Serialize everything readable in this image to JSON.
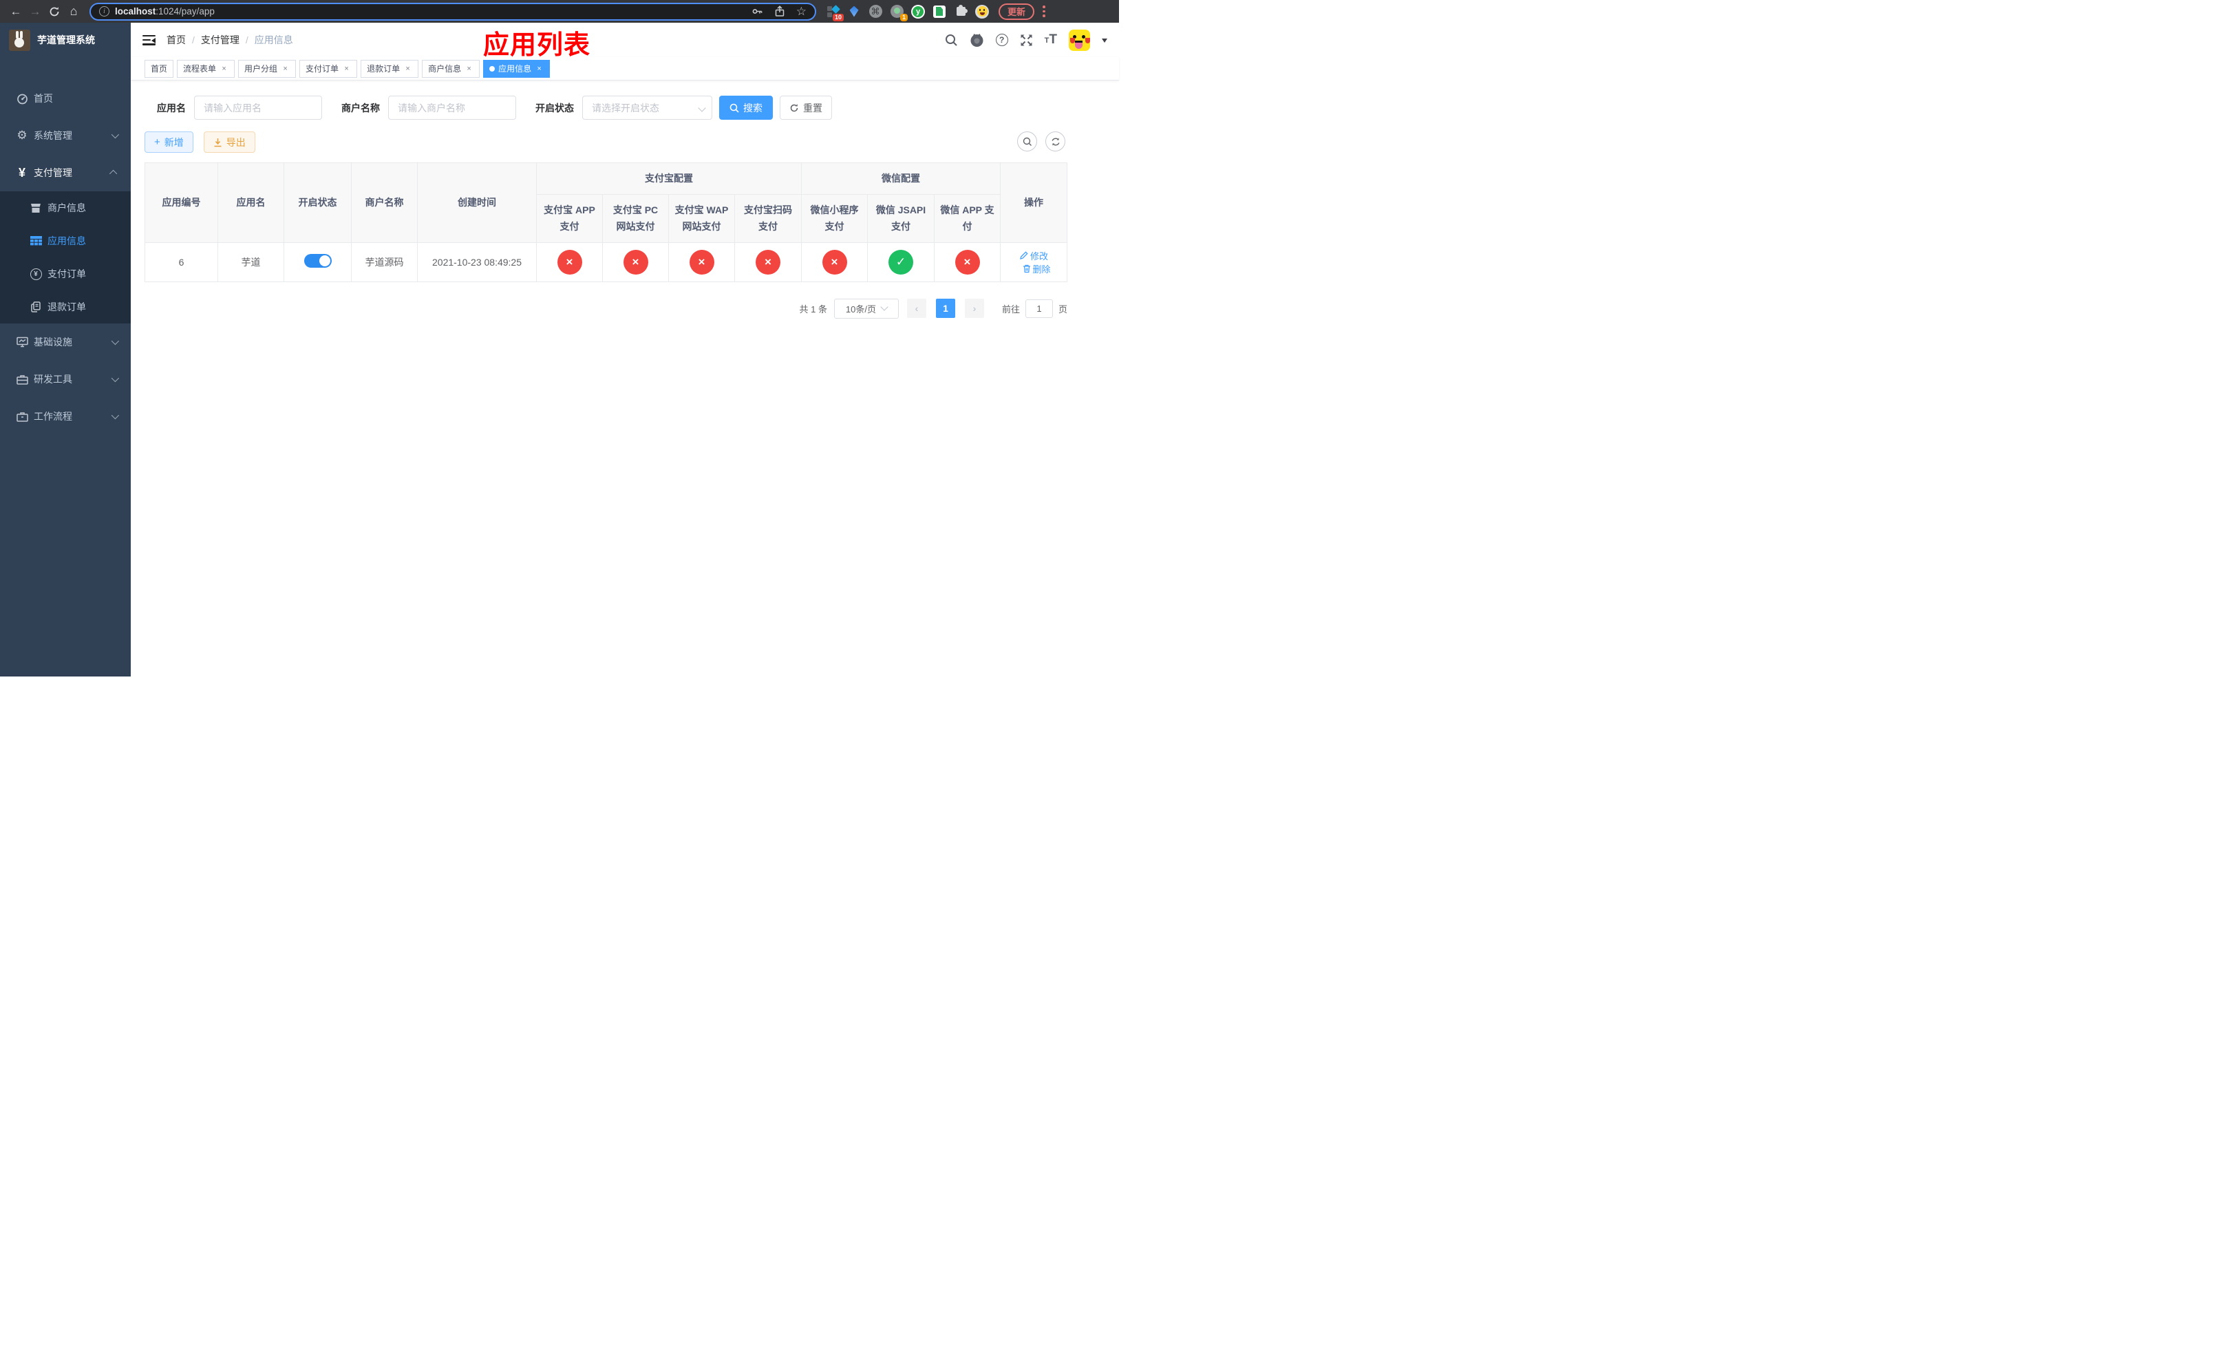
{
  "browser": {
    "url_host": "localhost",
    "url_path": ":1024/pay/app",
    "update_label": "更新",
    "ext_badge_1": "10",
    "ext_badge_2": "1",
    "ext_y_letter": "y"
  },
  "sidebar": {
    "title": "芋道管理系统",
    "menu_top": [
      {
        "label": "首页",
        "expandable": false
      },
      {
        "label": "系统管理",
        "expandable": true,
        "state": "collapsed"
      },
      {
        "label": "支付管理",
        "expandable": true,
        "state": "expanded"
      }
    ],
    "submenu": [
      {
        "label": "商户信息",
        "active": false
      },
      {
        "label": "应用信息",
        "active": true
      },
      {
        "label": "支付订单",
        "active": false
      },
      {
        "label": "退款订单",
        "active": false
      }
    ],
    "menu_bottom": [
      {
        "label": "基础设施",
        "expandable": true,
        "state": "collapsed"
      },
      {
        "label": "研发工具",
        "expandable": true,
        "state": "collapsed"
      },
      {
        "label": "工作流程",
        "expandable": true,
        "state": "collapsed"
      }
    ]
  },
  "navbar": {
    "breadcrumb": [
      "首页",
      "支付管理",
      "应用信息"
    ],
    "annotation": "应用列表"
  },
  "tabs": [
    {
      "label": "首页",
      "closable": false,
      "active": false
    },
    {
      "label": "流程表单",
      "closable": true,
      "active": false
    },
    {
      "label": "用户分组",
      "closable": true,
      "active": false
    },
    {
      "label": "支付订单",
      "closable": true,
      "active": false
    },
    {
      "label": "退款订单",
      "closable": true,
      "active": false
    },
    {
      "label": "商户信息",
      "closable": true,
      "active": false
    },
    {
      "label": "应用信息",
      "closable": true,
      "active": true
    }
  ],
  "filters": {
    "app_name_label": "应用名",
    "app_name_placeholder": "请输入应用名",
    "merchant_label": "商户名称",
    "merchant_placeholder": "请输入商户名称",
    "status_label": "开启状态",
    "status_placeholder": "请选择开启状态",
    "search_label": "搜索",
    "reset_label": "重置"
  },
  "toolbar": {
    "add_label": "新增",
    "export_label": "导出"
  },
  "table": {
    "cols": [
      "应用编号",
      "应用名",
      "开启状态",
      "商户名称",
      "创建时间",
      "操作"
    ],
    "groups": [
      "支付宝配置",
      "微信配置"
    ],
    "subcols": [
      "支付宝 APP 支付",
      "支付宝 PC 网站支付",
      "支付宝 WAP 网站支付",
      "支付宝扫码支付",
      "微信小程序支付",
      "微信 JSAPI 支付",
      "微信 APP 支付"
    ],
    "row": {
      "id": "6",
      "name": "芋道",
      "switch_on": true,
      "merchant": "芋道源码",
      "created": "2021-10-23 08:49:25",
      "statuses": [
        {
          "glyph": "×",
          "state": "off"
        },
        {
          "glyph": "×",
          "state": "off"
        },
        {
          "glyph": "×",
          "state": "off"
        },
        {
          "glyph": "×",
          "state": "off"
        },
        {
          "glyph": "×",
          "state": "off"
        },
        {
          "glyph": "✓",
          "state": "on"
        },
        {
          "glyph": "×",
          "state": "off"
        }
      ],
      "edit_label": "修改",
      "delete_label": "删除"
    }
  },
  "pagination": {
    "total": "共 1 条",
    "page_size": "10条/页",
    "prev": "‹",
    "next": "›",
    "current": "1",
    "goto_label": "前往",
    "goto_value": "1",
    "goto_suffix": "页"
  },
  "colors": {
    "accent": "#409EFF",
    "danger": "#f3453f",
    "success": "#1dbf62",
    "sidebar_bg": "#304156",
    "submenu_bg": "#1f2d3d",
    "annotation": "#fe0000"
  }
}
